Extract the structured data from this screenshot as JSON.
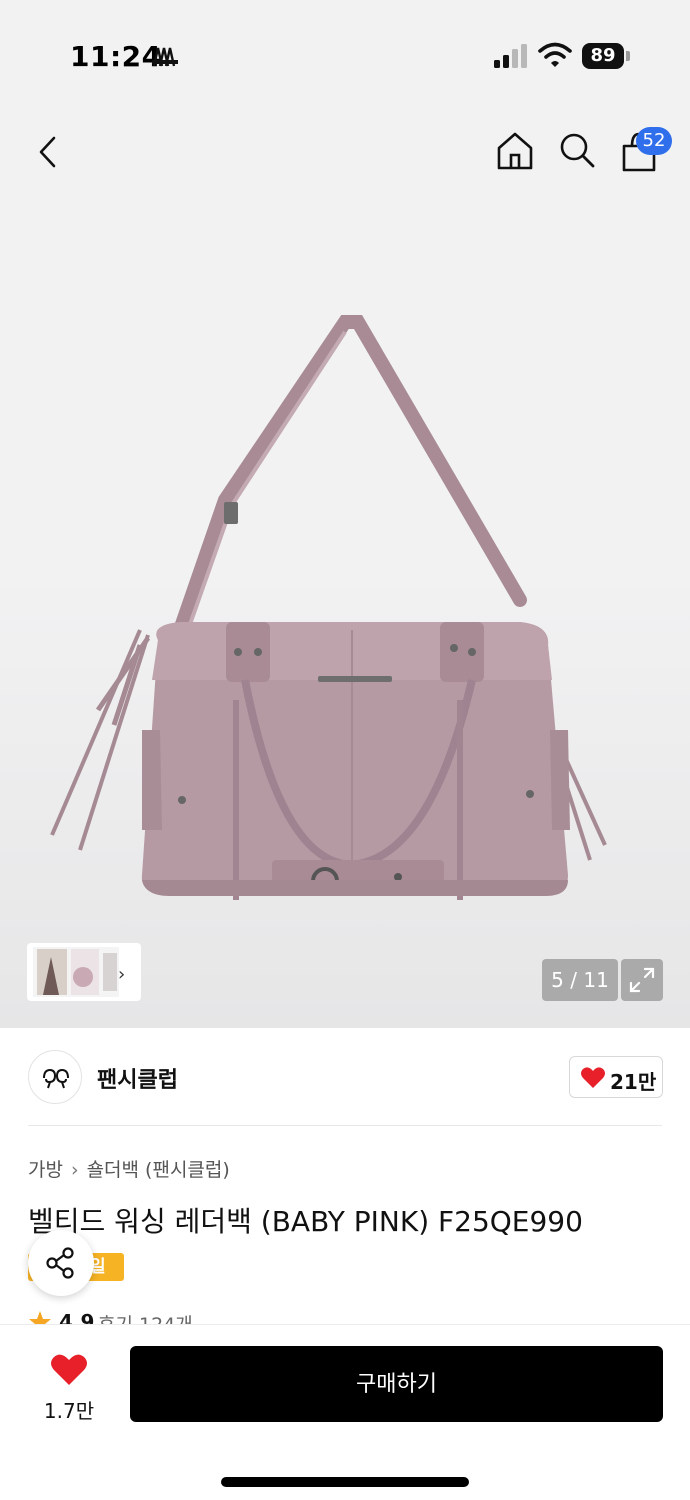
{
  "status_bar": {
    "time": "11:24",
    "battery": "89"
  },
  "nav": {
    "cart_count": "52",
    "icons": [
      "back-arrow-icon",
      "home-icon",
      "search-icon",
      "shopping-bag-icon"
    ]
  },
  "gallery": {
    "counter": "5 / 11",
    "product_color": "#b69aa3"
  },
  "brand": {
    "name": "팬시클럽",
    "likes": "21만"
  },
  "product": {
    "breadcrumb": [
      "가방",
      "숄더백 (팬시클럽)"
    ],
    "title": "벨티드 워싱 레더백 (BABY PINK) F25QE990",
    "sale_badge": "일",
    "rating": "4.9",
    "reviews": "후기 124개"
  },
  "bottom_bar": {
    "wish_count": "1.7만",
    "buy_label": "구매하기"
  },
  "colors": {
    "accent_badge": "#2f6fec",
    "heart": "#e8202a",
    "sale": "#f6b324",
    "buy_button": "#000000"
  }
}
